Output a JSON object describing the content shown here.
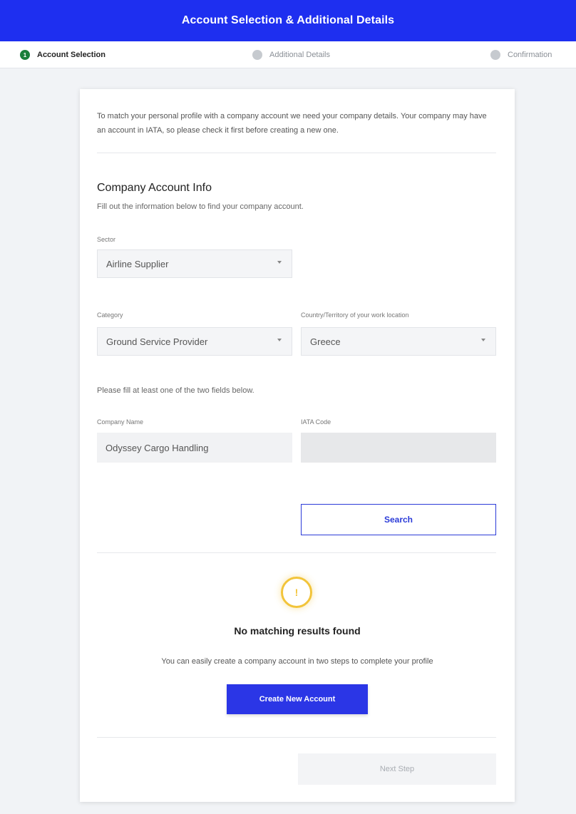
{
  "header": {
    "title": "Account Selection & Additional Details"
  },
  "stepper": {
    "steps": [
      {
        "label": "Account Selection",
        "number": "1",
        "state": "active"
      },
      {
        "label": "Additional Details",
        "number": "",
        "state": "inactive"
      },
      {
        "label": "Confirmation",
        "number": "",
        "state": "inactive"
      }
    ]
  },
  "card": {
    "intro": "To match your personal profile with a company account we need your company details. Your company may have an account in IATA, so please check it first before creating a new one.",
    "section_title": "Company Account Info",
    "section_subtitle": "Fill out the information below to find your company account.",
    "sector": {
      "label": "Sector",
      "value": "Airline Supplier"
    },
    "category": {
      "label": "Category",
      "value": "Ground Service Provider"
    },
    "country": {
      "label": "Country/Territory of your work location",
      "value": "Greece"
    },
    "fill_hint": "Please fill at least one of the two fields below.",
    "company_name": {
      "label": "Company Name",
      "value": "Odyssey Cargo Handling"
    },
    "iata_code": {
      "label": "IATA Code",
      "value": ""
    },
    "search_label": "Search",
    "warning_icon": "!",
    "no_results": "No matching results found",
    "create_hint": "You can easily create a company account in two steps to complete your profile",
    "create_label": "Create New Account",
    "next_label": "Next Step"
  },
  "colors": {
    "brand": "#1e2ff0",
    "primary_button": "#2b36e6",
    "active_step": "#1b7f3b",
    "warning": "#f2c43a"
  }
}
